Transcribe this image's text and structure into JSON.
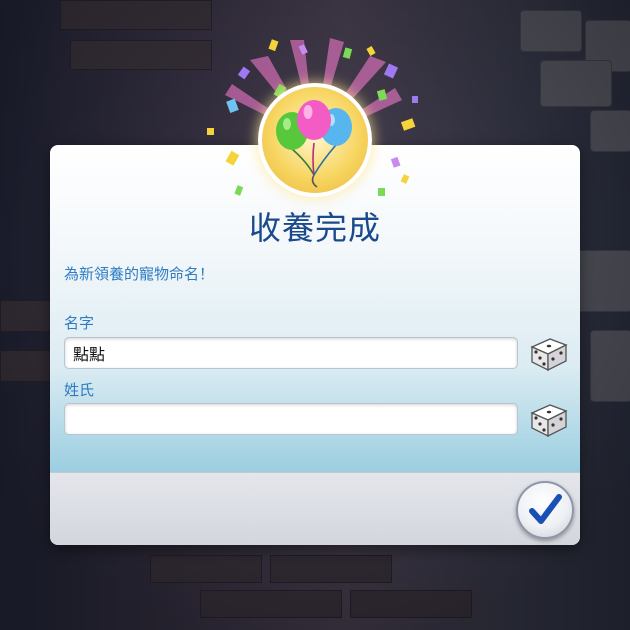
{
  "dialog": {
    "title": "收養完成",
    "subtitle": "為新領養的寵物命名！",
    "first_name": {
      "label": "名字",
      "value": "點點"
    },
    "last_name": {
      "label": "姓氏",
      "value": ""
    }
  },
  "icons": {
    "badge": "balloons-icon",
    "randomize": "dice-icon",
    "confirm": "checkmark-icon"
  },
  "colors": {
    "title": "#1b4a8c",
    "label": "#2f7cc1",
    "confirm_check": "#1a4fb5"
  }
}
